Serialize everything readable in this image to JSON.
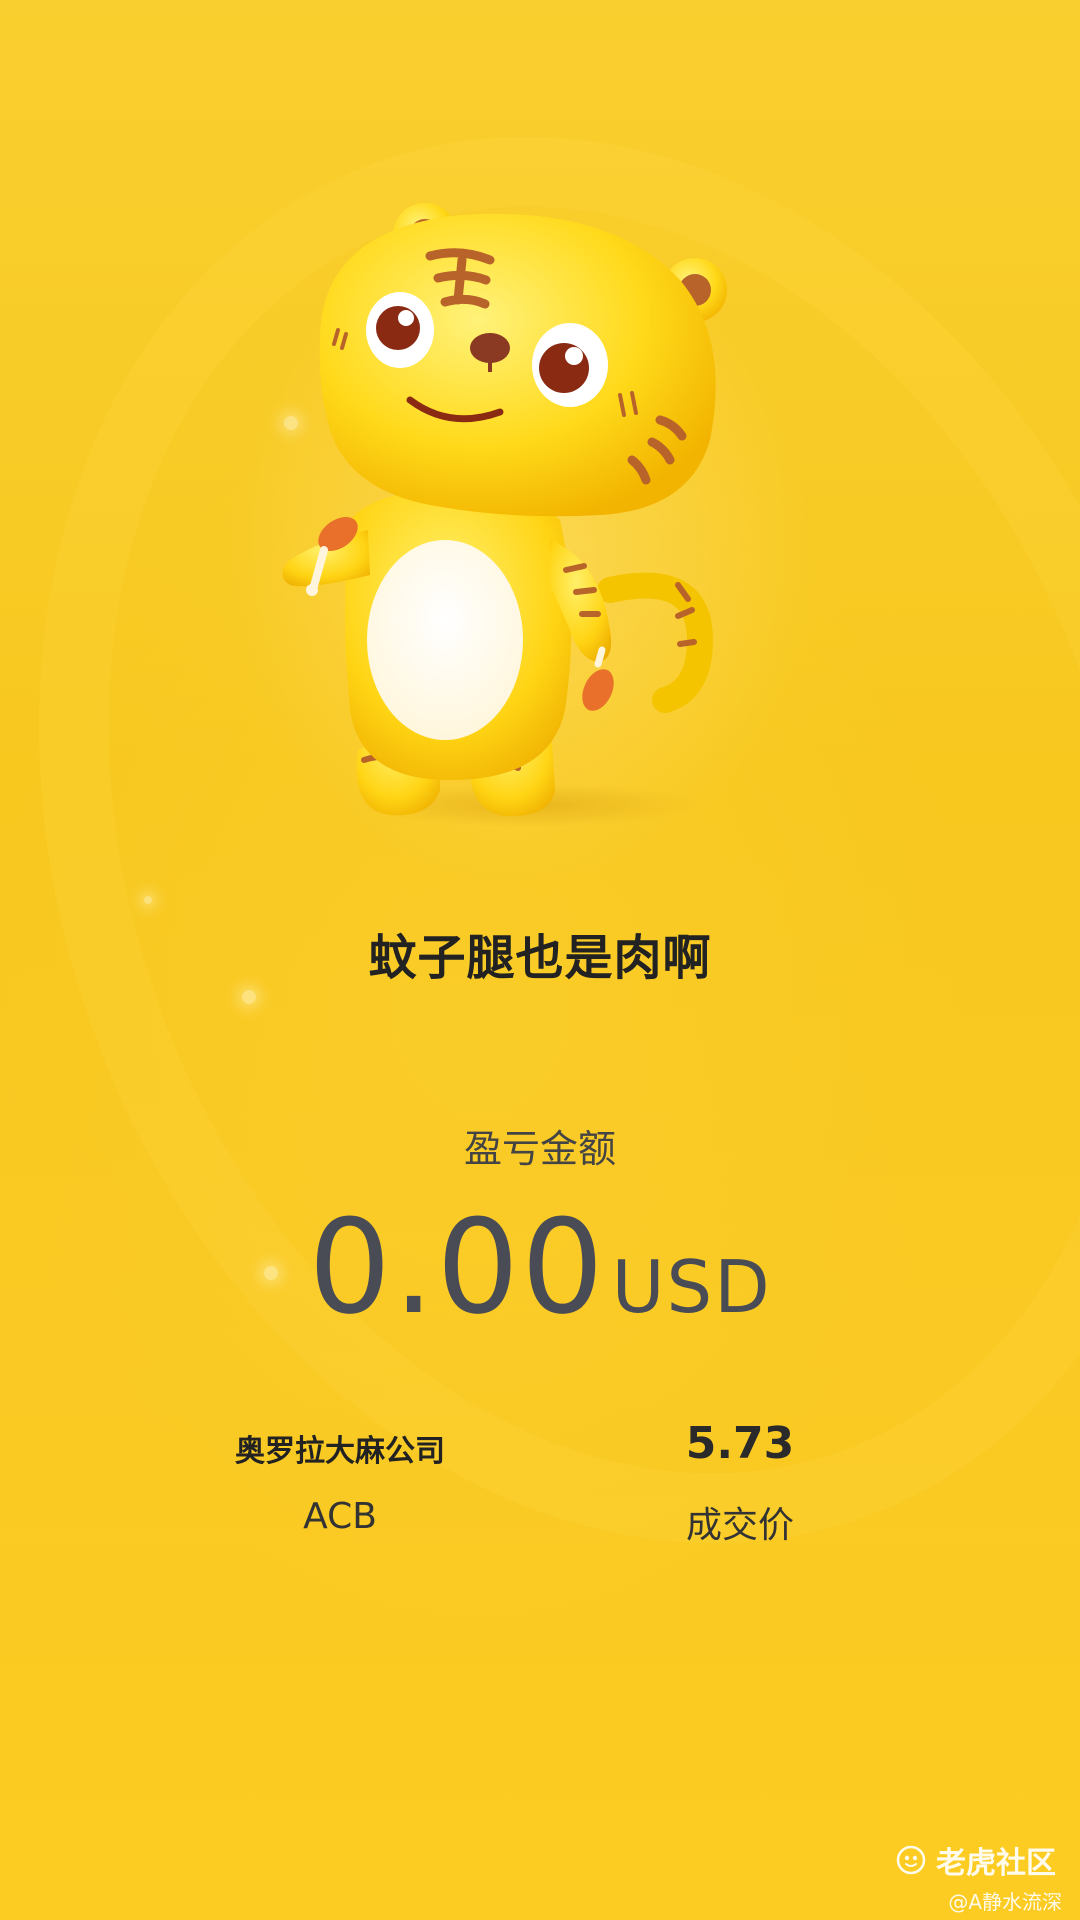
{
  "card": {
    "title": "蚊子腿也是肉啊",
    "pl_label": "盈亏金额",
    "pl_value": "0.00",
    "pl_currency": "USD"
  },
  "stock": {
    "name": "奥罗拉大麻公司",
    "ticker": "ACB",
    "price": "5.73",
    "price_label": "成交价"
  },
  "footer": {
    "brand": "老虎社区",
    "user": "@A静水流深"
  },
  "colors": {
    "background": "#f8c81f",
    "amount_text": "#4a4c55",
    "title_text": "#222222"
  },
  "icons": {
    "mascot": "tiger-mascot-icon",
    "brand": "tiger-brand-icon"
  }
}
